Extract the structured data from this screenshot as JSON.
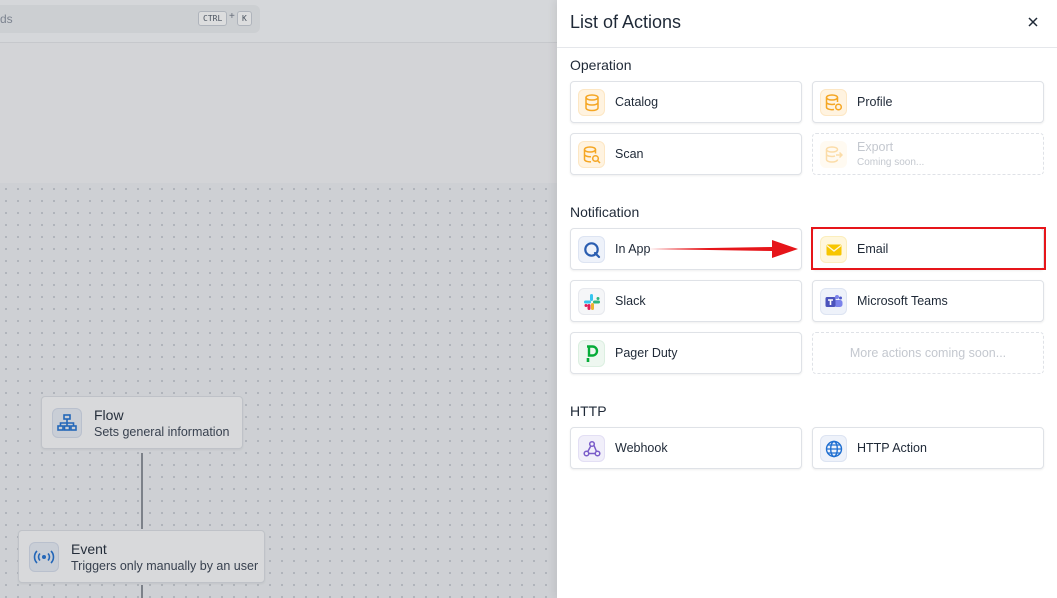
{
  "background": {
    "search": {
      "placeholder_fragment": "ds",
      "shortcut_ctrl": "CTRL",
      "shortcut_plus": "+",
      "shortcut_key": "K"
    },
    "flow_node": {
      "title": "Flow",
      "subtitle": "Sets general information",
      "icon": "sitemap-icon"
    },
    "event_node": {
      "title": "Event",
      "subtitle": "Triggers only manually by an user",
      "icon": "broadcast-icon"
    }
  },
  "drawer": {
    "title": "List of Actions",
    "close_icon": "close-icon",
    "sections": {
      "operation": {
        "label": "Operation",
        "items": {
          "catalog": {
            "label": "Catalog",
            "icon": "database-icon"
          },
          "profile": {
            "label": "Profile",
            "icon": "database-gear-icon"
          },
          "scan": {
            "label": "Scan",
            "icon": "database-search-icon"
          },
          "export": {
            "label": "Export",
            "sub": "Coming soon...",
            "icon": "export-icon"
          }
        }
      },
      "notification": {
        "label": "Notification",
        "items": {
          "in_app": {
            "label": "In App",
            "icon": "app-logo-icon"
          },
          "email": {
            "label": "Email",
            "icon": "envelope-icon"
          },
          "slack": {
            "label": "Slack",
            "icon": "slack-icon"
          },
          "teams": {
            "label": "Microsoft Teams",
            "icon": "teams-icon"
          },
          "pager_duty": {
            "label": "Pager Duty",
            "icon": "pagerduty-icon"
          },
          "more": {
            "label": "More actions coming soon..."
          }
        }
      },
      "http": {
        "label": "HTTP",
        "items": {
          "webhook": {
            "label": "Webhook",
            "icon": "webhook-icon"
          },
          "http_action": {
            "label": "HTTP Action",
            "icon": "globe-icon"
          }
        }
      }
    }
  },
  "colors": {
    "highlight": "#e6151a",
    "accent_blue": "#1f6fd1",
    "icon_orange": "#f5a623"
  }
}
